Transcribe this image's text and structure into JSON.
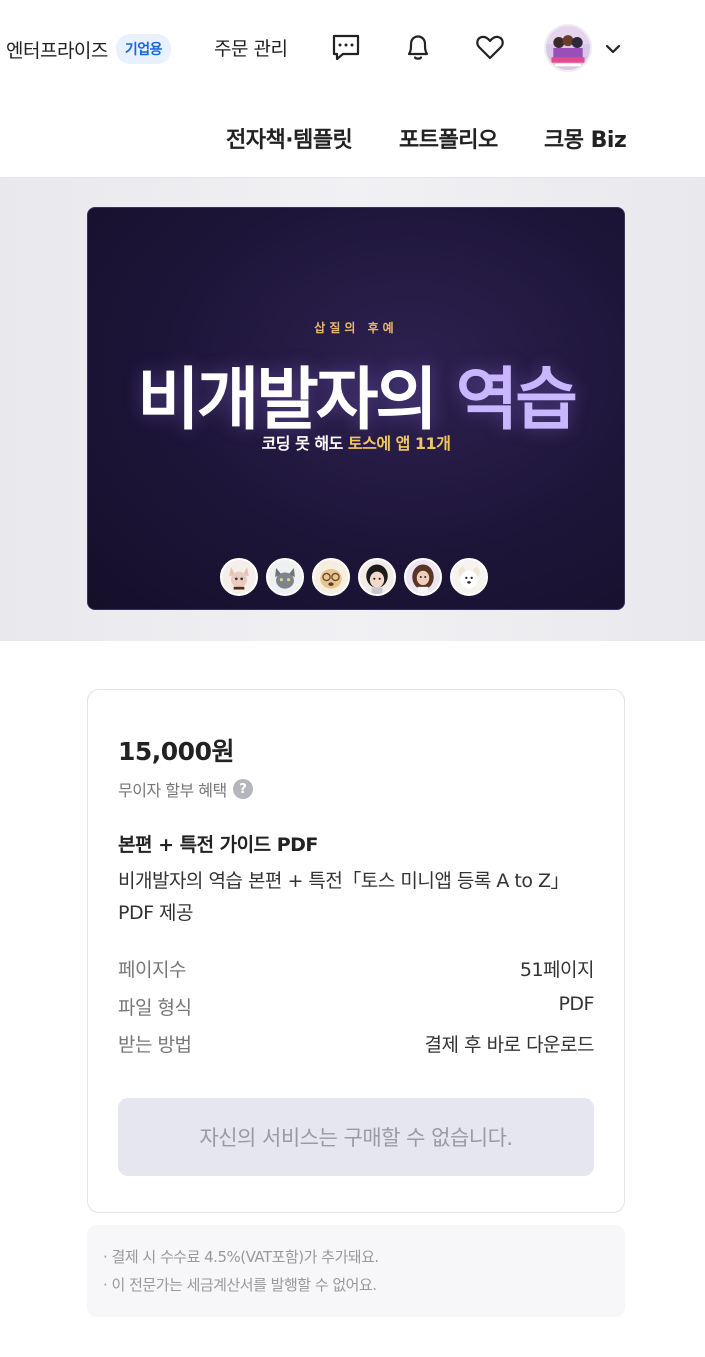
{
  "header": {
    "enterprise_label": "엔터프라이즈",
    "enterprise_badge": "기업용",
    "orders_label": "주문 관리",
    "icons": [
      "chat-icon",
      "bell-icon",
      "heart-icon"
    ]
  },
  "nav": {
    "items": [
      {
        "label": "전자책·템플릿"
      },
      {
        "label": "포트폴리오"
      },
      {
        "label": "크몽 Biz"
      }
    ]
  },
  "cover": {
    "subtitle": "삽질의 후예",
    "title_main": "비개발자의",
    "title_highlight": "역습",
    "tagline_main": "코딩 못 해도",
    "tagline_highlight": "토스에 앱 11개",
    "accent_color": "#c8b6ff",
    "highlight_color": "#f3c560"
  },
  "product": {
    "price": "15,000원",
    "installment": "무이자 할부 혜택",
    "package_title": "본편 + 특전 가이드 PDF",
    "package_desc": "비개발자의 역습 본편 + 특전「토스 미니앱 등록 A to Z」PDF 제공",
    "specs": [
      {
        "key": "페이지수",
        "value": "51페이지"
      },
      {
        "key": "파일 형식",
        "value": "PDF"
      },
      {
        "key": "받는 방법",
        "value": "결제 후 바로 다운로드"
      }
    ],
    "buy_label": "자신의 서비스는 구매할 수 없습니다."
  },
  "notice": {
    "lines": [
      "· 결제 시 수수료 4.5%(VAT포함)가 추가돼요.",
      "· 이 전문가는 세금계산서를 발행할 수 없어요."
    ]
  }
}
